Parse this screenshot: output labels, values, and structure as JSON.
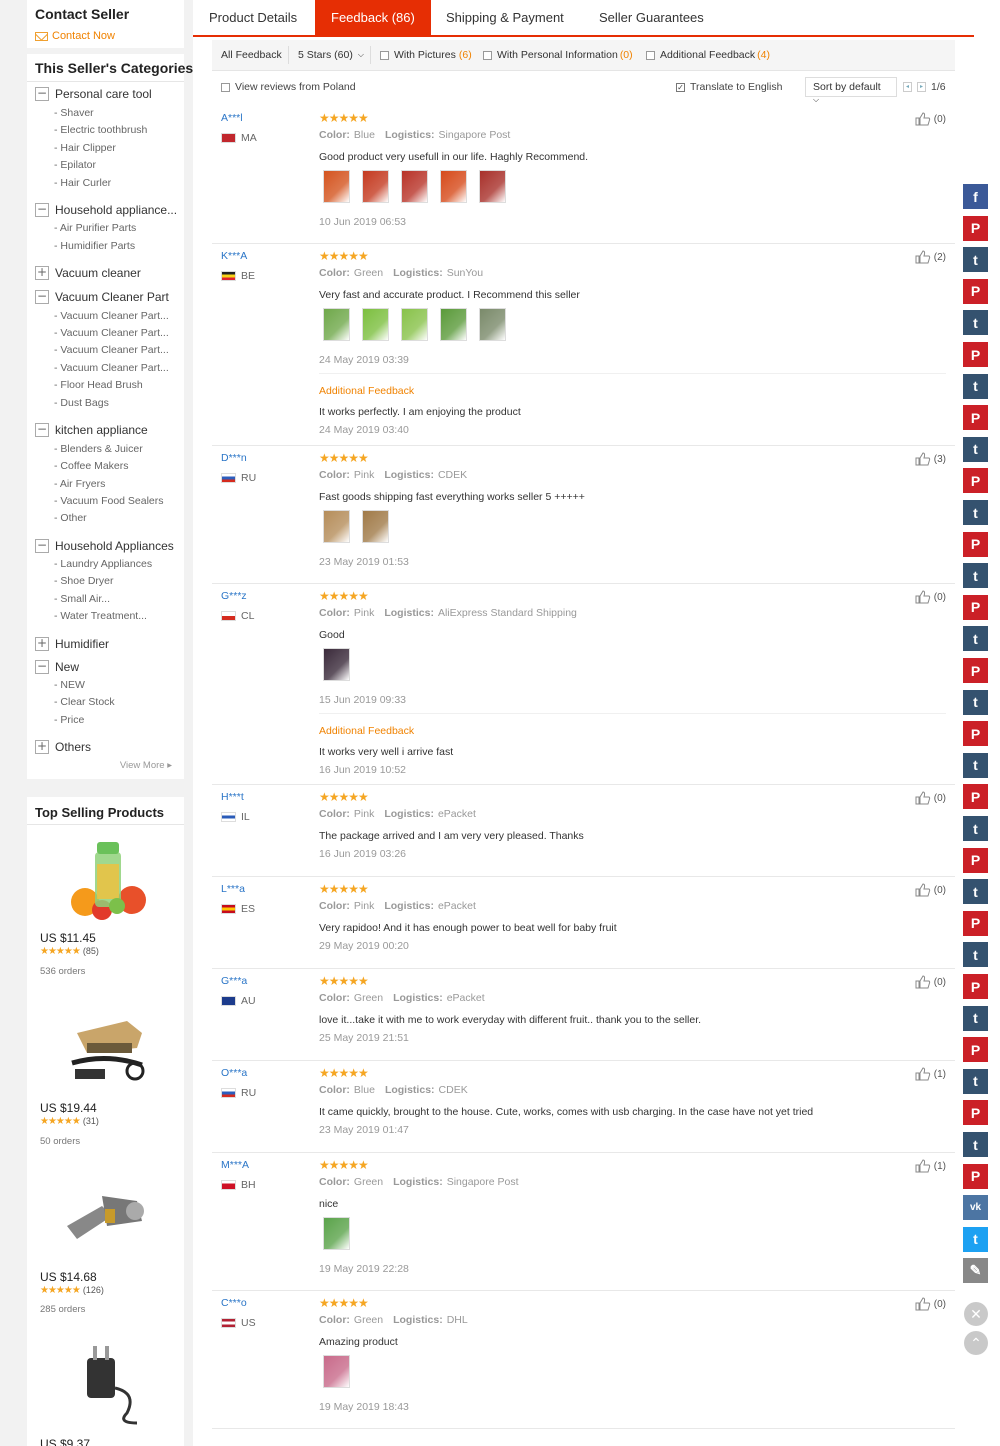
{
  "left": {
    "contact": {
      "title": "Contact Seller",
      "link": "Contact Now"
    },
    "categories_title": "This Seller's Categories",
    "categories": [
      {
        "label": "Personal care tool",
        "toggle": "−",
        "subs": [
          "- Shaver",
          "- Electric toothbrush",
          "- Hair Clipper",
          "- Epilator",
          "- Hair Curler"
        ]
      },
      {
        "label": "Household appliance...",
        "toggle": "−",
        "subs": [
          "- Air Purifier Parts",
          "- Humidifier Parts"
        ]
      },
      {
        "label": "Vacuum cleaner",
        "toggle": "+",
        "subs": []
      },
      {
        "label": "Vacuum Cleaner Part",
        "toggle": "−",
        "subs": [
          "- Vacuum Cleaner Part...",
          "- Vacuum Cleaner Part...",
          "- Vacuum Cleaner Part...",
          "- Vacuum Cleaner Part...",
          "- Floor Head Brush",
          "- Dust Bags"
        ]
      },
      {
        "label": "kitchen appliance",
        "toggle": "−",
        "subs": [
          "- Blenders & Juicer",
          "- Coffee Makers",
          "- Air Fryers",
          "- Vacuum Food Sealers",
          "- Other"
        ]
      },
      {
        "label": "Household Appliances",
        "toggle": "−",
        "subs": [
          "- Laundry Appliances",
          "- Shoe Dryer",
          "- Small Air...",
          "- Water Treatment..."
        ]
      },
      {
        "label": "Humidifier",
        "toggle": "+",
        "subs": []
      },
      {
        "label": "New",
        "toggle": "−",
        "subs": [
          "- NEW",
          "- Clear Stock",
          "- Price"
        ]
      },
      {
        "label": "Others",
        "toggle": "+",
        "subs": []
      }
    ],
    "view_more": "View More ▸",
    "top_title": "Top Selling Products",
    "products": [
      {
        "price": "US $11.45",
        "stars": "★★★★★",
        "count": "(85)",
        "orders": "536 orders",
        "img": "juicer"
      },
      {
        "price": "US $19.44",
        "stars": "★★★★★",
        "count": "(31)",
        "orders": "50 orders",
        "img": "car-vacuum"
      },
      {
        "price": "US $14.68",
        "stars": "★★★★★",
        "count": "(126)",
        "orders": "285 orders",
        "img": "vacuum-part"
      },
      {
        "price": "US $9.37",
        "stars": "",
        "count": "",
        "orders": "",
        "img": "adapter"
      }
    ]
  },
  "tabs": [
    {
      "label": "Product Details",
      "active": false
    },
    {
      "label": "Feedback (86)",
      "active": true
    },
    {
      "label": "Shipping & Payment",
      "active": false
    },
    {
      "label": "Seller Guarantees",
      "active": false
    }
  ],
  "filters": {
    "all": "All Feedback",
    "stars": "5 Stars (60)",
    "pictures": "With Pictures",
    "pictures_count": "(6)",
    "personal": "With Personal Information",
    "personal_count": "(0)",
    "additional": "Additional Feedback",
    "additional_count": "(4)",
    "poland": "View reviews from Poland",
    "translate": "Translate to English",
    "sort": "Sort by default",
    "page": "1/6"
  },
  "reviews": [
    {
      "user": "A***l",
      "country": "MA",
      "flag": [
        "#c1272d",
        "#c1272d"
      ],
      "color": "Blue",
      "logistics": "Singapore Post",
      "text": "Good product very usefull in our life. Haghly Recommend.",
      "thumbs": [
        "#d4541f",
        "#c43a20",
        "#b83328",
        "#d64a1a",
        "#a8302a"
      ],
      "date": "10 Jun 2019 06:53",
      "likes": "(0)",
      "add_text": "",
      "add_date": ""
    },
    {
      "user": "K***A",
      "country": "BE",
      "flag": [
        "#222",
        "#f7d417",
        "#e0232f"
      ],
      "color": "Green",
      "logistics": "SunYou",
      "text": "Very fast and accurate product. I Recommend this seller",
      "thumbs": [
        "#6fa84a",
        "#7cbf3f",
        "#88c24a",
        "#5a9a3a",
        "#7a8a6a"
      ],
      "date": "24 May 2019 03:39",
      "likes": "(2)",
      "add_text": "It works perfectly. I am enjoying the product",
      "add_date": "24 May 2019 03:40"
    },
    {
      "user": "D***n",
      "country": "RU",
      "flag": [
        "#fff",
        "#2c5ebd",
        "#d52b1e"
      ],
      "color": "Pink",
      "logistics": "CDEK",
      "text": "Fast goods shipping fast everything works seller 5 +++++",
      "thumbs": [
        "#b58d5a",
        "#a07a48"
      ],
      "date": "23 May 2019 01:53",
      "likes": "(3)",
      "add_text": "",
      "add_date": ""
    },
    {
      "user": "G***z",
      "country": "CL",
      "flag": [
        "#fff",
        "#d52b1e"
      ],
      "color": "Pink",
      "logistics": "AliExpress Standard Shipping",
      "text": "Good",
      "thumbs": [
        "#3a2a3a"
      ],
      "date": "15 Jun 2019 09:33",
      "likes": "(0)",
      "add_text": "It works very well i arrive fast",
      "add_date": "16 Jun 2019 10:52"
    },
    {
      "user": "H***t",
      "country": "IL",
      "flag": [
        "#fff",
        "#2a5bb8",
        "#fff"
      ],
      "color": "Pink",
      "logistics": "ePacket",
      "text": "The package arrived and I am very very pleased. Thanks",
      "thumbs": [],
      "date": "16 Jun 2019 03:26",
      "likes": "(0)",
      "add_text": "",
      "add_date": ""
    },
    {
      "user": "L***a",
      "country": "ES",
      "flag": [
        "#c60b1e",
        "#ffc400",
        "#c60b1e"
      ],
      "color": "Pink",
      "logistics": "ePacket",
      "text": "Very rapidoo! And it has enough power to beat well for baby fruit",
      "thumbs": [],
      "date": "29 May 2019 00:20",
      "likes": "(0)",
      "add_text": "",
      "add_date": ""
    },
    {
      "user": "G***a",
      "country": "AU",
      "flag": [
        "#1c3b8c",
        "#1c3b8c"
      ],
      "color": "Green",
      "logistics": "ePacket",
      "text": "love it...take it with me to work everyday with different fruit.. thank you to the seller.",
      "thumbs": [],
      "date": "25 May 2019 21:51",
      "likes": "(0)",
      "add_text": "",
      "add_date": ""
    },
    {
      "user": "O***a",
      "country": "RU",
      "flag": [
        "#fff",
        "#2c5ebd",
        "#d52b1e"
      ],
      "color": "Blue",
      "logistics": "CDEK",
      "text": "It came quickly, brought to the house. Cute, works, comes with usb charging. In the case have not yet tried",
      "thumbs": [],
      "date": "23 May 2019 01:47",
      "likes": "(1)",
      "add_text": "",
      "add_date": ""
    },
    {
      "user": "M***A",
      "country": "BH",
      "flag": [
        "#fff",
        "#ce1126",
        "#ce1126"
      ],
      "color": "Green",
      "logistics": "Singapore Post",
      "text": "nice",
      "thumbs": [
        "#5aa34a"
      ],
      "date": "19 May 2019 22:28",
      "likes": "(1)",
      "add_text": "",
      "add_date": ""
    },
    {
      "user": "C***o",
      "country": "US",
      "flag": [
        "#b22234",
        "#fff",
        "#b22234"
      ],
      "color": "Green",
      "logistics": "DHL",
      "text": "Amazing product",
      "thumbs": [
        "#c86a8a"
      ],
      "date": "19 May 2019 18:43",
      "likes": "(0)",
      "add_text": "",
      "add_date": ""
    }
  ],
  "labels": {
    "color": "Color:",
    "logistics": "Logistics:",
    "additional_feedback": "Additional Feedback",
    "stars": "★★★★★"
  },
  "share": [
    "facebook",
    "pinterest",
    "tumblr",
    "pinterest",
    "tumblr",
    "pinterest",
    "tumblr",
    "pinterest",
    "tumblr",
    "pinterest",
    "tumblr",
    "pinterest",
    "tumblr",
    "pinterest",
    "tumblr",
    "pinterest",
    "tumblr",
    "pinterest",
    "tumblr",
    "pinterest",
    "tumblr",
    "pinterest",
    "tumblr",
    "pinterest",
    "tumblr",
    "pinterest",
    "tumblr",
    "pinterest",
    "tumblr",
    "pinterest",
    "tumblr",
    "pinterest",
    "vk",
    "twitter",
    "edit"
  ]
}
